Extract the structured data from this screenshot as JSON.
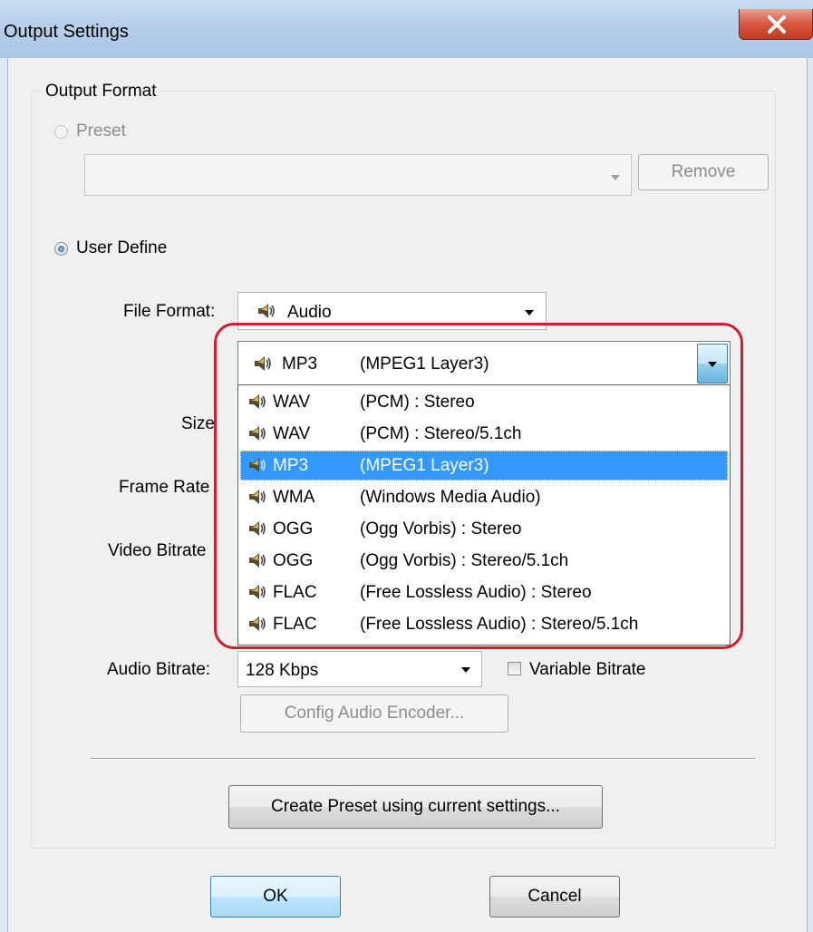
{
  "window": {
    "title": "Output Settings"
  },
  "output_format": {
    "group_title": "Output Format",
    "preset_label": "Preset",
    "preset_value": "",
    "remove_label": "Remove",
    "user_define_label": "User Define",
    "file_format_label": "File Format:",
    "file_format_value": "Audio",
    "codec_selected_code": "MP3",
    "codec_selected_desc": "(MPEG1 Layer3)",
    "size_label": "Size",
    "frame_rate_label": "Frame Rate",
    "video_bitrate_label": "Video Bitrate",
    "audio_bitrate_label": "Audio Bitrate:",
    "audio_bitrate_value": "128 Kbps",
    "variable_bitrate_label": "Variable Bitrate",
    "config_audio_label": "Config Audio Encoder...",
    "create_preset_label": "Create Preset using current settings..."
  },
  "codec_list": [
    {
      "code": "WAV",
      "desc": "(PCM) : Stereo",
      "selected": false
    },
    {
      "code": "WAV",
      "desc": "(PCM) : Stereo/5.1ch",
      "selected": false
    },
    {
      "code": "MP3",
      "desc": "(MPEG1 Layer3)",
      "selected": true
    },
    {
      "code": "WMA",
      "desc": "(Windows Media Audio)",
      "selected": false
    },
    {
      "code": "OGG",
      "desc": "(Ogg Vorbis) : Stereo",
      "selected": false
    },
    {
      "code": "OGG",
      "desc": "(Ogg Vorbis) : Stereo/5.1ch",
      "selected": false
    },
    {
      "code": "FLAC",
      "desc": "(Free Lossless Audio) : Stereo",
      "selected": false
    },
    {
      "code": "FLAC",
      "desc": "(Free Lossless Audio) : Stereo/5.1ch",
      "selected": false
    }
  ],
  "buttons": {
    "ok_label": "OK",
    "cancel_label": "Cancel"
  },
  "icons": {
    "close": "close-icon",
    "speaker": "speaker-icon",
    "dropdown": "chevron-down-icon"
  },
  "colors": {
    "selection": "#3399ff",
    "highlight_ring": "#cf1f2f",
    "close_button": "#c23a21"
  }
}
